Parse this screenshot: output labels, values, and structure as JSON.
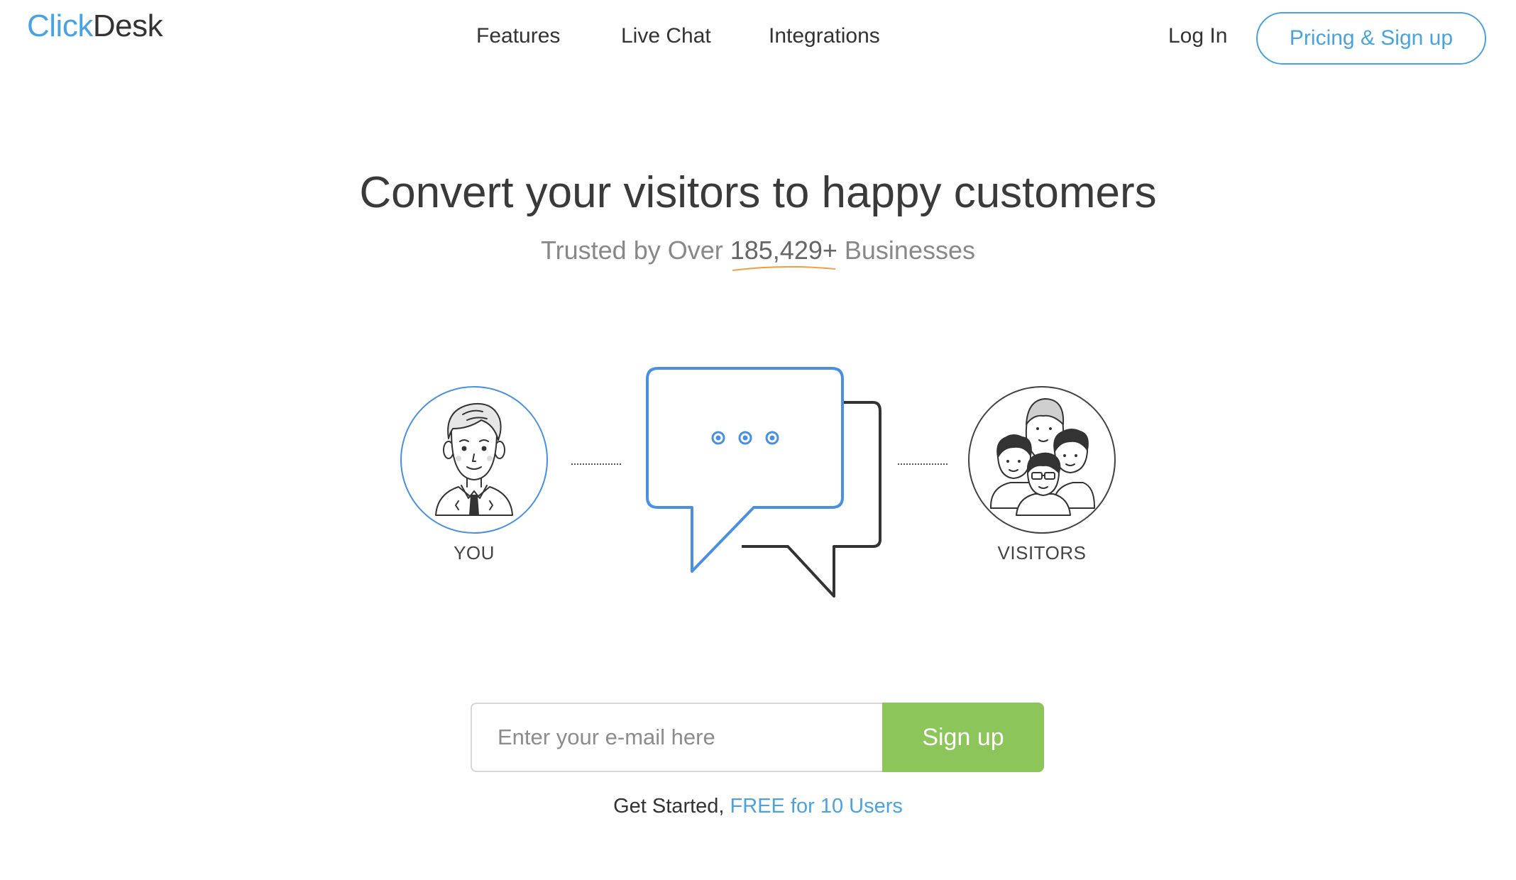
{
  "brand": {
    "logo_part1": "Click",
    "logo_part2": "Desk",
    "accent_color": "#4aa3df",
    "cta_color": "#8cc65a"
  },
  "nav": {
    "features": "Features",
    "live_chat": "Live Chat",
    "integrations": "Integrations",
    "login": "Log In",
    "pricing_signup": "Pricing & Sign up"
  },
  "hero": {
    "title": "Convert your visitors to happy customers",
    "subtitle_prefix": "Trusted by Over ",
    "subtitle_count": "185,429+",
    "subtitle_suffix": " Businesses"
  },
  "illustration": {
    "you_label": "YOU",
    "visitors_label": "VISITORS",
    "you_icon": "agent-avatar-icon",
    "visitors_icon": "visitors-group-icon",
    "chat_icon": "chat-bubbles-icon"
  },
  "signup": {
    "email_placeholder": "Enter your e-mail here",
    "email_value": "",
    "button_label": "Sign up",
    "note_prefix": "Get Started, ",
    "note_link": "FREE for 10 Users"
  }
}
